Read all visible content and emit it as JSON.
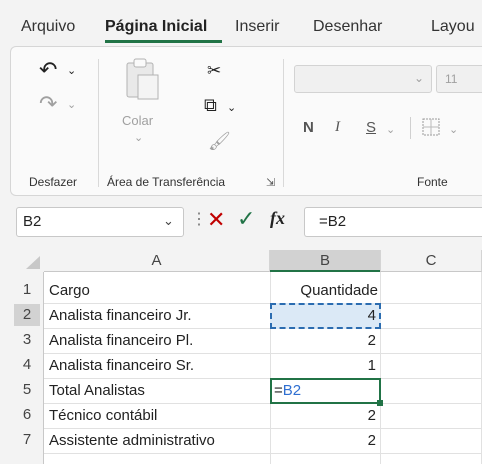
{
  "tabs": [
    "Arquivo",
    "Página Inicial",
    "Inserir",
    "Desenhar",
    "Layou"
  ],
  "ribbon": {
    "undo_group_label": "Desfazer",
    "clipboard_group_label": "Área de Transferência",
    "paste_label": "Colar",
    "font_group_label": "Fonte",
    "font_size_partial": "11",
    "bold_label": "N",
    "italic_label": "I",
    "underline_label": "S"
  },
  "formula_bar": {
    "name_box": "B2",
    "fx_label": "fx",
    "formula": "=B2"
  },
  "sheet": {
    "columns": [
      "A",
      "B",
      "C"
    ],
    "rows": [
      {
        "num": "1",
        "a": "Cargo",
        "b": "Quantidade"
      },
      {
        "num": "2",
        "a": "Analista financeiro Jr.",
        "b": "4"
      },
      {
        "num": "3",
        "a": "Analista financeiro Pl.",
        "b": "2"
      },
      {
        "num": "4",
        "a": "Analista financeiro Sr.",
        "b": "1"
      },
      {
        "num": "5",
        "a": "Total Analistas",
        "b": "=B2"
      },
      {
        "num": "6",
        "a": "Técnico contábil",
        "b": "2"
      },
      {
        "num": "7",
        "a": "Assistente administrativo",
        "b": "2"
      }
    ]
  },
  "colors": {
    "accent": "#217346",
    "copy_marquee": "#2b6cb0",
    "formula_ref": "#2f6fd1",
    "cancel_red": "#c00000"
  }
}
